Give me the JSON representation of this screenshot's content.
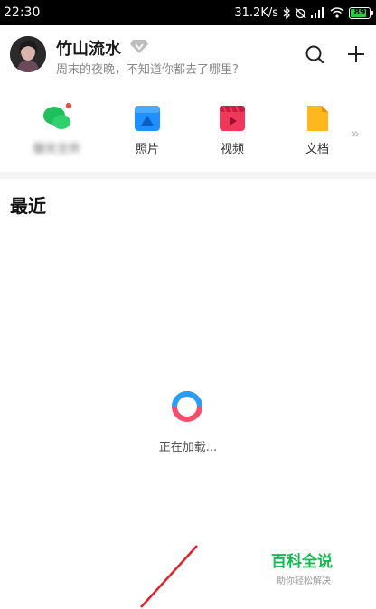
{
  "status_bar": {
    "time": "22:30",
    "net_speed": "31.2K/s",
    "battery": "89",
    "icons": [
      "bluetooth-icon",
      "alarm-off-icon",
      "signal-icon",
      "wifi-icon",
      "battery-icon"
    ]
  },
  "profile": {
    "name": "竹山流水",
    "motto": "周末的夜晚，不知道你都去了哪里?"
  },
  "quick_access": [
    {
      "label": "聊天文件",
      "icon": "chat-bubbles-icon",
      "color": "#1fbf5c",
      "badge": true
    },
    {
      "label": "照片",
      "icon": "photo-icon",
      "color": "#1e90ff"
    },
    {
      "label": "视频",
      "icon": "video-icon",
      "color": "#f2385a"
    },
    {
      "label": "文档",
      "icon": "document-icon",
      "color": "#ffb71b"
    }
  ],
  "section": {
    "title": "最近"
  },
  "loading": {
    "text": "正在加载..."
  },
  "watermark": {
    "title": "百科全说",
    "subtitle": "助你轻松解决"
  },
  "colors": {
    "accent_green": "#19b955",
    "spinner_blue": "#2a9df4",
    "spinner_red": "#f2506a"
  }
}
